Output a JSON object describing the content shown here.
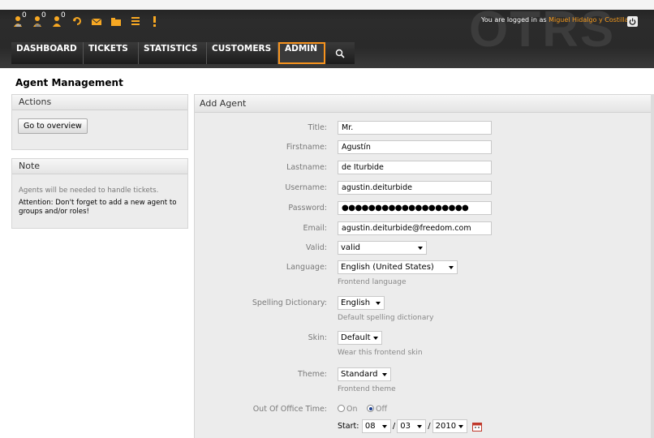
{
  "header": {
    "logo_text": "OTRS",
    "login_prefix": "You are logged in as ",
    "login_user": "Miguel Hidalgo y Costilla",
    "toolbar": {
      "badge_1": "0",
      "badge_2": "0",
      "badge_3": "0"
    },
    "nav": {
      "dashboard": "DASHBOARD",
      "tickets": "TICKETS",
      "statistics": "STATISTICS",
      "customers": "CUSTOMERS",
      "admin": "ADMIN"
    },
    "accent_color": "#f7931e"
  },
  "page": {
    "title": "Agent Management"
  },
  "sidebar": {
    "actions": {
      "header": "Actions",
      "overview_button": "Go to overview"
    },
    "note": {
      "header": "Note",
      "line1": "Agents will be needed to handle tickets.",
      "line2": "Attention: Don't forget to add a new agent to groups and/or roles!"
    }
  },
  "form": {
    "header": "Add Agent",
    "title": {
      "label": "Title:",
      "value": "Mr."
    },
    "firstname": {
      "label": "Firstname:",
      "value": "Agustín"
    },
    "lastname": {
      "label": "Lastname:",
      "value": "de Iturbide"
    },
    "username": {
      "label": "Username:",
      "value": "agustin.deiturbide"
    },
    "password": {
      "label": "Password:",
      "value": "●●●●●●●●●●●●●●●●●●●"
    },
    "email": {
      "label": "Email:",
      "value": "agustin.deiturbide@freedom.com"
    },
    "valid": {
      "label": "Valid:",
      "value": "valid"
    },
    "language": {
      "label": "Language:",
      "value": "English (United States)",
      "hint": "Frontend language"
    },
    "spelling": {
      "label": "Spelling Dictionary:",
      "value": "English",
      "hint": "Default spelling dictionary"
    },
    "skin": {
      "label": "Skin:",
      "value": "Default",
      "hint": "Wear this frontend skin"
    },
    "theme": {
      "label": "Theme:",
      "value": "Standard",
      "hint": "Frontend theme"
    },
    "out_of_office": {
      "label": "Out Of Office Time:",
      "on": "On",
      "off": "Off",
      "start_label": "Start:",
      "month": "08",
      "day": "03",
      "year": "2010"
    }
  }
}
